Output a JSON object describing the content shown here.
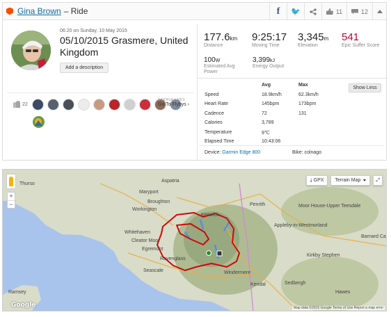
{
  "header": {
    "athlete_name": "Gina Brown",
    "separator": "– Ride",
    "share": {
      "facebook": "f",
      "twitter": "t"
    },
    "kudos_count": "11",
    "comment_count": "12"
  },
  "activity": {
    "datetime": "06:20 on Sunday, 10 May 2015",
    "title": "05/10/2015 Grasmere, United Kingdom",
    "add_description": "Add a description"
  },
  "stats_primary": [
    {
      "value": "177.6",
      "unit": "km",
      "label": "Distance"
    },
    {
      "value": "9:25:17",
      "unit": "",
      "label": "Moving Time"
    },
    {
      "value": "3,345",
      "unit": "m",
      "label": "Elevation"
    },
    {
      "value": "541",
      "unit": "",
      "label": "Epic Suffer Score"
    }
  ],
  "stats_secondary": [
    {
      "value": "100",
      "unit": "W",
      "label": "Estimated Avg Power"
    },
    {
      "value": "3,399",
      "unit": "kJ",
      "label": "Energy Output"
    }
  ],
  "detail_table": {
    "headers": {
      "avg": "Avg",
      "max": "Max"
    },
    "rows": [
      {
        "label": "Speed",
        "avg": "18.9km/h",
        "max": "62.3km/h"
      },
      {
        "label": "Heart Rate",
        "avg": "145bpm",
        "max": "173bpm"
      },
      {
        "label": "Cadence",
        "avg": "72",
        "max": "131"
      },
      {
        "label": "Calories",
        "avg": "3,789",
        "max": ""
      },
      {
        "label": "Temperature",
        "avg": "9℃",
        "max": ""
      },
      {
        "label": "Elapsed Time",
        "avg": "10:43:06",
        "max": ""
      }
    ],
    "show_less": "Show Less"
  },
  "device": {
    "label": "Device:",
    "name": "Garmin Edge 800"
  },
  "bike": {
    "label": "Bike:",
    "name": "colnago"
  },
  "group": {
    "count": "22",
    "strava_labs": "STRAVA LABS",
    "flyby": "Go To Flybys ›"
  },
  "athlete_thumbs": [
    {
      "color": "#3c4a66"
    },
    {
      "color": "#556070"
    },
    {
      "color": "#4a4f57"
    },
    {
      "color": "#ececec"
    },
    {
      "color": "#c99a82"
    },
    {
      "color": "#b8242a"
    },
    {
      "color": "#d0d0d0"
    },
    {
      "color": "#c8303a"
    },
    {
      "color": "#8a6a58"
    },
    {
      "color": "#7e8a98"
    }
  ],
  "map": {
    "gpx_label": "GPX",
    "terrain_label": "Terrain Map",
    "attribution": "Map data ©2015 Google   Terms of Use   Report a map error",
    "logo": "Google",
    "places": [
      "Aspatria",
      "Maryport",
      "Broughton",
      "Workington",
      "Whitehaven",
      "Cleator Moor",
      "Egremont",
      "Seascale",
      "Ramsey",
      "Penrith",
      "Appleby-in-Westmorland",
      "Moor House-Upper Teesdale",
      "Barnard Ca",
      "Kirkby Stephen",
      "Windermere",
      "Kendal",
      "Sedbergh",
      "Hawes",
      "Ravenglass",
      "Keswick",
      "Thurso"
    ]
  },
  "colors": {
    "accent": "#fc4c02",
    "link": "#0a6ea8",
    "suffer": "#c2002f",
    "route": "#cc0a0a"
  }
}
